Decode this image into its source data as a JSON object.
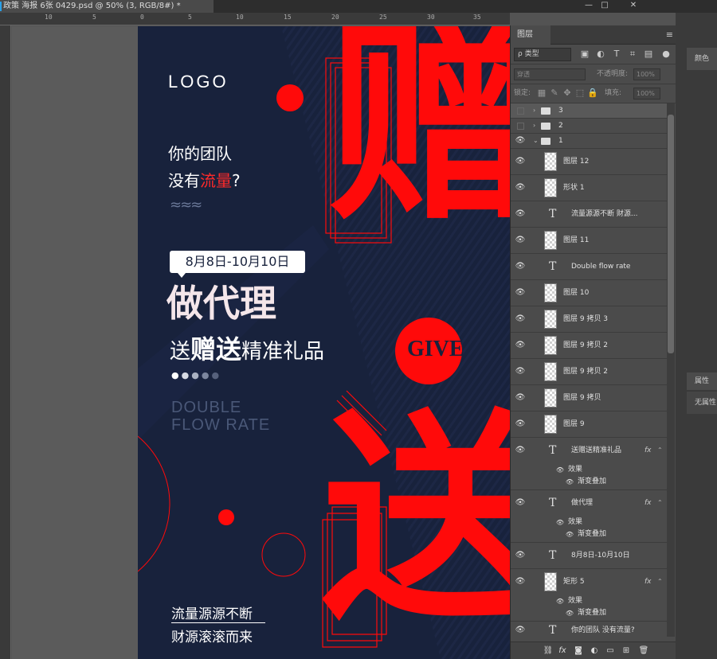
{
  "app": {
    "tab_title": "政策 海报 6张 0429.psd @ 50% (3, RGB/8#) *",
    "window_controls": [
      "—",
      "□",
      "✕"
    ]
  },
  "ruler": {
    "top_ticks": [
      "10",
      "5",
      "0",
      "5",
      "10",
      "15",
      "20",
      "25",
      "30",
      "35"
    ]
  },
  "poster": {
    "logo": "LOGO",
    "line1": "你的团队",
    "line2_pre": "没有",
    "line2_accent": "流量",
    "line2_post": "?",
    "wave": "≈≈≈",
    "date": "8月8日-10月10日",
    "headline": "做代理",
    "sub_pre": "送",
    "sub_bold": "赠送",
    "sub_post": "精准礼品",
    "dots": [
      "●",
      "●",
      "●",
      "●",
      "●"
    ],
    "eng1": "DOUBLE",
    "eng2": "FLOW RATE",
    "big_char1": "赠",
    "big_char2": "送",
    "give": "GIVE",
    "footer1": "流量源源不断",
    "footer2": "财源滚滚而来",
    "colors": {
      "bg": "#18223c",
      "accent": "#ff0a0a",
      "text": "#ffffff"
    }
  },
  "layers_panel": {
    "tab_label": "图层",
    "menu_icon": "≡",
    "filter_label": "ρ 类型",
    "blend_mode": "穿透",
    "opacity_label": "不透明度:",
    "opacity_value": "100%",
    "lock_label": "锁定:",
    "fill_label": "填充:",
    "fill_value": "100%",
    "layers": [
      {
        "name": "3",
        "kind": "folder",
        "visible": false
      },
      {
        "name": "2",
        "kind": "folder",
        "visible": false
      },
      {
        "name": "1",
        "kind": "folder-open",
        "visible": true
      },
      {
        "name": "图层 12",
        "kind": "raster",
        "visible": true
      },
      {
        "name": "形状 1",
        "kind": "shape",
        "visible": true
      },
      {
        "name": "流量源源不断 财源...",
        "kind": "text",
        "visible": true
      },
      {
        "name": "图层 11",
        "kind": "raster",
        "visible": true
      },
      {
        "name": "Double flow rate",
        "kind": "text",
        "visible": true
      },
      {
        "name": "图层 10",
        "kind": "raster",
        "visible": true
      },
      {
        "name": "图层 9 拷贝 3",
        "kind": "raster",
        "visible": true
      },
      {
        "name": "图层 9 拷贝 2",
        "kind": "raster",
        "visible": true
      },
      {
        "name": "图层 9 拷贝 2",
        "kind": "raster",
        "visible": true
      },
      {
        "name": "图层 9 拷贝",
        "kind": "raster",
        "visible": true
      },
      {
        "name": "图层 9",
        "kind": "raster",
        "visible": true
      },
      {
        "name": "送赠送精准礼品",
        "kind": "text",
        "visible": true,
        "fx": "fx",
        "effects_label": "效果",
        "effect": "渐变叠加"
      },
      {
        "name": "做代理",
        "kind": "text",
        "visible": true,
        "fx": "fx",
        "effects_label": "效果",
        "effect": "渐变叠加"
      },
      {
        "name": "8月8日-10月10日",
        "kind": "text",
        "visible": true
      },
      {
        "name": "矩形 5",
        "kind": "shape",
        "visible": true,
        "fx": "fx",
        "effects_label": "效果",
        "effect": "渐变叠加"
      },
      {
        "name": "你的团队 没有流量?",
        "kind": "text",
        "visible": true
      }
    ],
    "bottom_icons": [
      "link-icon",
      "fx-icon",
      "mask-icon",
      "adjustment-icon",
      "folder-icon",
      "new-layer-icon",
      "trash-icon"
    ]
  },
  "side_panels": {
    "color": "颜色",
    "properties": "属性",
    "no_properties": "无属性"
  }
}
